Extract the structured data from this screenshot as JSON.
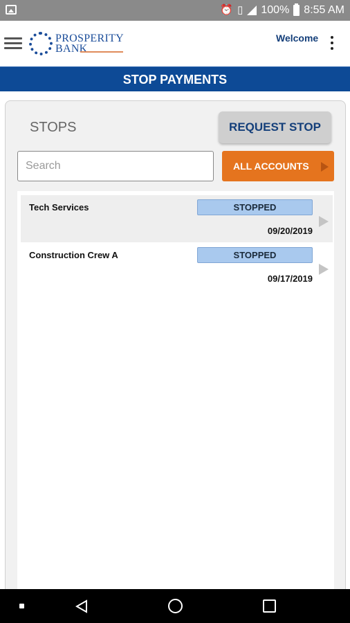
{
  "status_bar": {
    "battery": "100%",
    "time": "8:55 AM"
  },
  "header": {
    "logo_line1": "PROSPERITY",
    "logo_line2": "BANK",
    "welcome": "Welcome"
  },
  "title": "STOP PAYMENTS",
  "stops": {
    "heading": "STOPS",
    "request_button": "REQUEST STOP",
    "search_placeholder": "Search",
    "accounts_button": "ALL ACCOUNTS",
    "items": [
      {
        "name": "Tech Services",
        "status": "STOPPED",
        "date": "09/20/2019"
      },
      {
        "name": "Construction Crew A",
        "status": "STOPPED",
        "date": "09/17/2019"
      }
    ]
  },
  "colors": {
    "brand_blue": "#0d4a96",
    "accent_orange": "#e5741e",
    "badge_blue": "#a9c9ee"
  }
}
